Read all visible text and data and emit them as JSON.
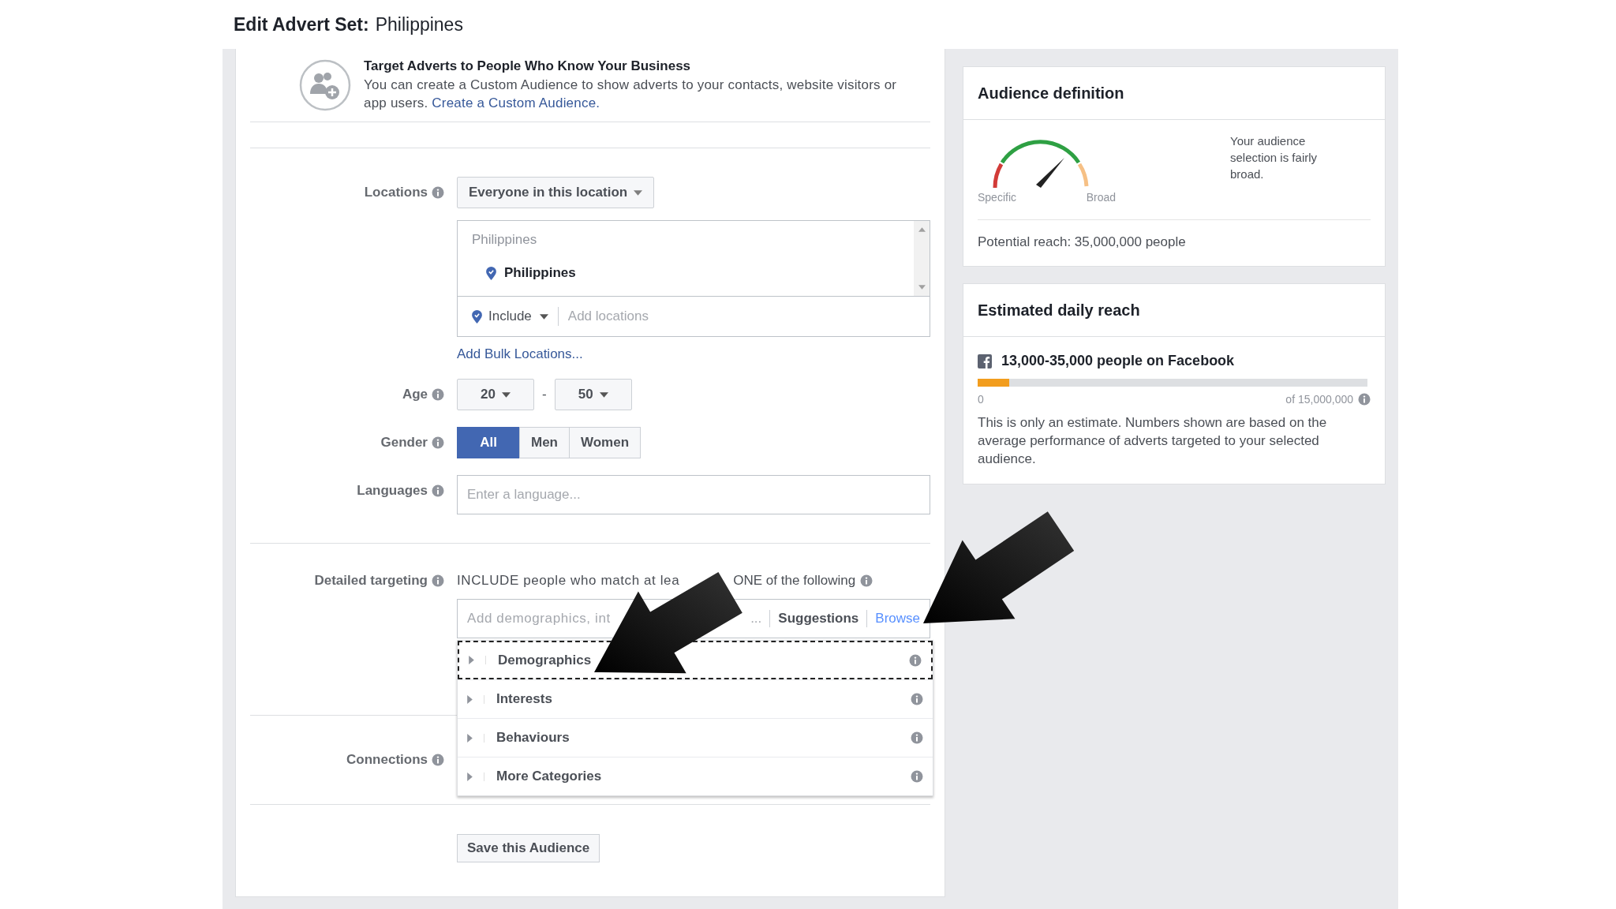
{
  "title": {
    "label": "Edit Advert Set:",
    "name": "Philippines"
  },
  "custom_audience": {
    "heading": "Target Adverts to People Who Know Your Business",
    "text": "You can create a Custom Audience to show adverts to your contacts, website visitors or app users.",
    "link": "Create a Custom Audience."
  },
  "locations": {
    "label": "Locations",
    "mode": "Everyone in this location",
    "list_heading": "Philippines",
    "items": [
      "Philippines"
    ],
    "include": "Include",
    "placeholder": "Add locations",
    "bulk_link": "Add Bulk Locations..."
  },
  "age": {
    "label": "Age",
    "from": "20",
    "separator": "-",
    "to": "50"
  },
  "gender": {
    "label": "Gender",
    "options": [
      {
        "label": "All",
        "selected": true
      },
      {
        "label": "Men",
        "selected": false
      },
      {
        "label": "Women",
        "selected": false
      }
    ]
  },
  "languages": {
    "label": "Languages",
    "placeholder": "Enter a language..."
  },
  "detailed_targeting": {
    "label": "Detailed targeting",
    "hint_start": "INCLUDE people who match at lea",
    "hint_end": "ONE of the following",
    "placeholder_start": "Add demographics, int",
    "placeholder_end": "...",
    "tabs": [
      {
        "label": "Suggestions",
        "selected": false
      },
      {
        "label": "Browse",
        "selected": true
      }
    ],
    "categories": [
      {
        "label": "Demographics",
        "selected": true
      },
      {
        "label": "Interests",
        "selected": false
      },
      {
        "label": "Behaviours",
        "selected": false
      },
      {
        "label": "More Categories",
        "selected": false
      }
    ]
  },
  "connections": {
    "label": "Connections"
  },
  "save_button": "Save this Audience",
  "audience_definition": {
    "title": "Audience definition",
    "specific": "Specific",
    "broad": "Broad",
    "summary": "Your audience selection is fairly broad.",
    "potential_reach": "Potential reach: 35,000,000 people"
  },
  "daily_reach": {
    "title": "Estimated daily reach",
    "headline": "13,000-35,000 people on Facebook",
    "level": 0.08,
    "min": "0",
    "max": "of 15,000,000",
    "note": "This is only an estimate. Numbers shown are based on the average performance of adverts targeted to your selected audience."
  }
}
